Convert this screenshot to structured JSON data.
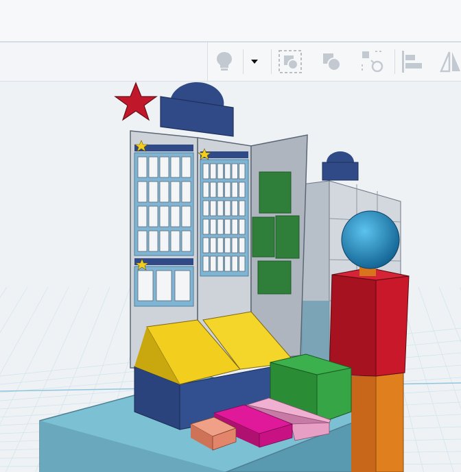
{
  "app": {},
  "toolbar": {
    "items": [
      {
        "name": "notes-lightbulb",
        "icon": "lightbulb-icon"
      },
      {
        "name": "notes-dropdown",
        "icon": "caret-down-icon"
      },
      {
        "name": "group",
        "icon": "group-icon"
      },
      {
        "name": "ungroup",
        "icon": "ungroup-icon"
      },
      {
        "name": "align-select",
        "icon": "select-dashed-icon"
      },
      {
        "name": "align",
        "icon": "align-left-icon"
      },
      {
        "name": "mirror",
        "icon": "mirror-icon"
      }
    ]
  },
  "workplane": {
    "grid_color": "#cfe3ec",
    "grid_accent": "#8ec5dc"
  },
  "colors": {
    "base": "#6fb7cc",
    "navy": "#2f4a86",
    "yellow": "#f2cf1f",
    "green": "#2f9d3c",
    "red": "#c0182a",
    "orange": "#d8741c",
    "pink": "#e79fc6",
    "magenta": "#d01586",
    "salmon": "#e3856a",
    "blue_sphere": "#1d8dc3",
    "panel_light": "#c8ced6",
    "window_blue": "#7fb5d3"
  }
}
